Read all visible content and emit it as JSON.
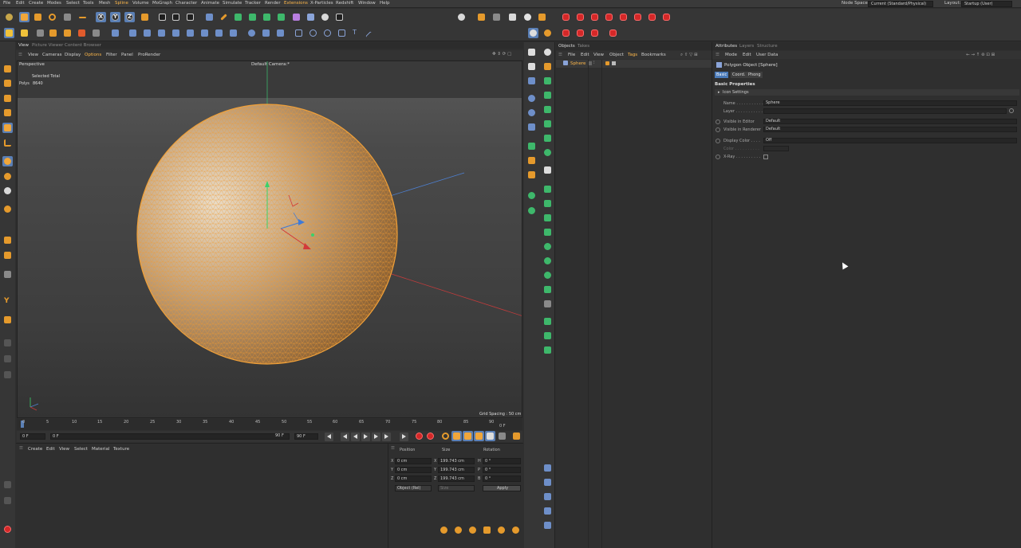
{
  "menu": {
    "items": [
      "File",
      "Edit",
      "Create",
      "Modes",
      "Select",
      "Tools",
      "Mesh",
      "Spline",
      "Volume",
      "MoGraph",
      "Character",
      "Animate",
      "Simulate",
      "Tracker",
      "Render",
      "Extensions",
      "X-Particles",
      "Redshift",
      "Window",
      "Help"
    ],
    "highlighted": [
      "Spline",
      "Extensions"
    ],
    "node_space_label": "Node Space:",
    "node_space_value": "Current (Standard/Physical)",
    "layout_label": "Layout:",
    "layout_value": "Startup (User)"
  },
  "viewport": {
    "tabs": [
      "View",
      "Picture Viewer",
      "Content Browser"
    ],
    "menu": [
      "View",
      "Cameras",
      "Display",
      "Options",
      "Filter",
      "Panel",
      "ProRender"
    ],
    "projection": "Perspective",
    "camera": "Default Camera:*",
    "stats_header": "Selected Total",
    "polys_label": "Polys",
    "polys_value": "8640",
    "grid_spacing": "Grid Spacing : 50 cm",
    "colors": {
      "wire": "#e9972f",
      "sphere_center": "#d9c4a6",
      "sphere_edge": "#c07a2a"
    }
  },
  "timeline": {
    "ticks": [
      "0",
      "5",
      "10",
      "15",
      "20",
      "25",
      "30",
      "35",
      "40",
      "45",
      "50",
      "55",
      "60",
      "65",
      "70",
      "75",
      "80",
      "85",
      "90"
    ],
    "current_frame_right": "0 F",
    "start_field": "0 F",
    "min_field": "0 F",
    "max_field": "90 F",
    "end_field": "90 F"
  },
  "material_manager": {
    "menu": [
      "Create",
      "Edit",
      "View",
      "Select",
      "Material",
      "Texture"
    ]
  },
  "coordinates": {
    "headers": [
      "Position",
      "Size",
      "Rotation"
    ],
    "rows": [
      {
        "axis": "X",
        "pos": "0 cm",
        "size_axis": "X",
        "size": "199.743 cm",
        "rot_axis": "H",
        "rot": "0 °"
      },
      {
        "axis": "Y",
        "pos": "0 cm",
        "size_axis": "Y",
        "size": "199.743 cm",
        "rot_axis": "P",
        "rot": "0 °"
      },
      {
        "axis": "Z",
        "pos": "0 cm",
        "size_axis": "Z",
        "size": "199.743 cm",
        "rot_axis": "B",
        "rot": "0 °"
      }
    ],
    "mode_select": "Object (Rel)",
    "size_select": "Size",
    "apply_label": "Apply"
  },
  "objects_panel": {
    "tabs": [
      "Objects",
      "Takes"
    ],
    "menu": [
      "File",
      "Edit",
      "View",
      "Object",
      "Tags",
      "Bookmarks"
    ],
    "items": [
      {
        "name": "Sphere"
      }
    ]
  },
  "attributes_panel": {
    "tabs": [
      "Attributes",
      "Layers",
      "Structure"
    ],
    "menu": [
      "Mode",
      "Edit",
      "User Data"
    ],
    "object_title": "Polygon Object [Sphere]",
    "sub_tabs": [
      "Basic",
      "Coord.",
      "Phong"
    ],
    "active_sub_tab": "Basic",
    "section": "Basic Properties",
    "icon_settings": "Icon Settings",
    "fields": [
      {
        "label": "Name . . . . . . . . . . .",
        "value": "Sphere"
      },
      {
        "label": "Layer . . . . . . . . . . .",
        "value": ""
      },
      {
        "label": "Visible in Editor",
        "value": "Default"
      },
      {
        "label": "Visible in Renderer",
        "value": "Default"
      },
      {
        "label": "Display Color . . . .",
        "value": "Off"
      },
      {
        "label": "Color . . . . . . . . . .",
        "value": ""
      },
      {
        "label": "X-Ray . . . . . . . . . .",
        "value": ""
      }
    ]
  }
}
